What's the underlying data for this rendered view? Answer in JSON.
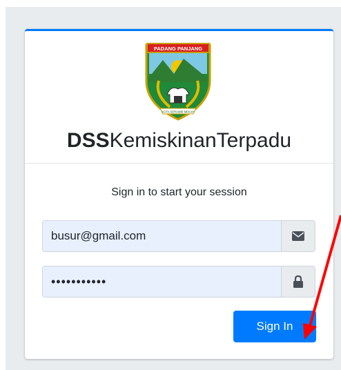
{
  "logo": {
    "banner_text": "PADANG PANJANG",
    "motto_text": "KOTA SERAMBI MEKAH"
  },
  "brand": {
    "bold": "DSS",
    "rest": "KemiskinanTerpadu"
  },
  "login": {
    "message": "Sign in to start your session",
    "email_value": "busur@gmail.com",
    "email_icon": "envelope-icon",
    "password_value": "12345678901",
    "password_icon": "lock-icon",
    "submit_label": "Sign In"
  },
  "colors": {
    "primary": "#007bff",
    "annotation_arrow": "#ff0000",
    "input_autofill_bg": "#e8f0fe"
  }
}
